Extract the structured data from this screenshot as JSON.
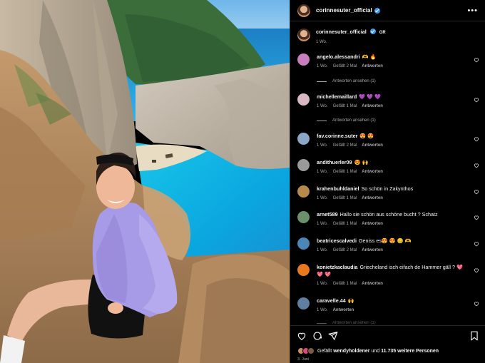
{
  "post": {
    "author": "corinnesuter_official",
    "image_alt": "Woman in lavender top sitting on cliffs above turquoise bay with a shipwreck on the beach"
  },
  "caption": {
    "username": "corinnesuter_official",
    "badge": "GR",
    "time": "1 Wo."
  },
  "labels": {
    "reply": "Antworten",
    "view_replies": "Antworten ansehen (1)"
  },
  "comments": [
    {
      "username": "angelo.alessandri",
      "text": "🫶 🔥",
      "time": "1 Wo.",
      "likes": "Gefällt 2 Mal",
      "avatar_color": "#c77dbe"
    },
    {
      "username": "michellemaillard",
      "text": "💜 💜 💜",
      "time": "1 Wo.",
      "likes": "Gefällt 1 Mal",
      "avatar_color": "#d9b8c4"
    },
    {
      "username": "fav.corinne.suter",
      "text": "😍 😍",
      "time": "1 Wo.",
      "likes": "Gefällt 2 Mal",
      "avatar_color": "#8aa7c9"
    },
    {
      "username": "andithuerler09",
      "text": "😍 🙌",
      "time": "1 Wo.",
      "likes": "Gefällt 1 Mal",
      "avatar_color": "#9a9a9a"
    },
    {
      "username": "krahenbuhldaniel",
      "text": "So schön in Zakynthos",
      "time": "1 Wo.",
      "likes": "Gefällt 1 Mal",
      "avatar_color": "#b58a4a"
    },
    {
      "username": "arnet589",
      "text": "Hallo sie schön aus schöne bucht ? Schatz",
      "time": "1 Wo.",
      "likes": "Gefällt 1 Mal",
      "avatar_color": "#6a8f6a"
    },
    {
      "username": "beatricescalvedi",
      "text": "Geniss es😍 😍 😊 🫶",
      "time": "1 Wo.",
      "likes": "Gefällt 2 Mal",
      "avatar_color": "#4a86b8"
    },
    {
      "username": "konietzkaclaudia",
      "text": "Griecheland isch eifach de Hammer gäll ? 💖 💖 💖",
      "time": "1 Wo.",
      "likes": "Gefällt 1 Mal",
      "avatar_color": "#e8791f"
    },
    {
      "username": "caravelle.44",
      "text": "🙌",
      "time": "1 Wo.",
      "likes": "",
      "avatar_color": "#5f7fa0"
    }
  ],
  "footer": {
    "liked_prefix": "Gefällt",
    "liked_user": "wendyholdener",
    "liked_and": "und",
    "liked_others": "11.735 weitere Personen",
    "date": "3. Juni"
  },
  "icons": [
    "more-icon",
    "heart-icon",
    "comment-icon",
    "share-icon",
    "bookmark-icon",
    "verified-icon"
  ],
  "colors": {
    "background": "#000000",
    "muted": "#a8a8a8",
    "verified": "#3897f0",
    "divider": "#262626"
  }
}
